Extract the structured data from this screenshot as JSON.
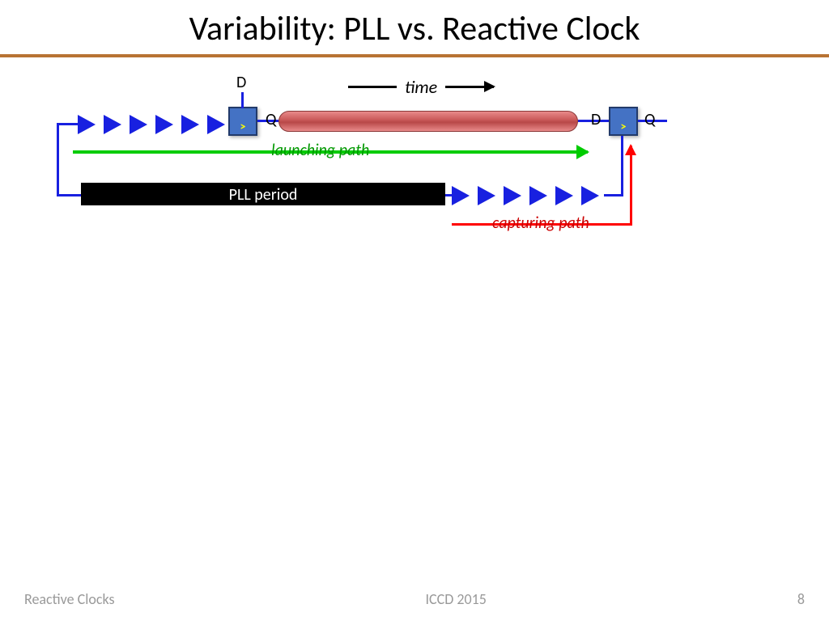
{
  "title": "Variability: PLL vs. Reactive Clock",
  "timeLabel": "time",
  "ff1": {
    "d": "D",
    "q": "Q"
  },
  "ff2": {
    "d": "D",
    "q": "Q"
  },
  "launchingPath": "launching path",
  "pllPeriod": "PLL period",
  "capturingPath": "capturing path",
  "footer": {
    "left": "Reactive Clocks",
    "center": "ICCD 2015",
    "page": "8"
  }
}
